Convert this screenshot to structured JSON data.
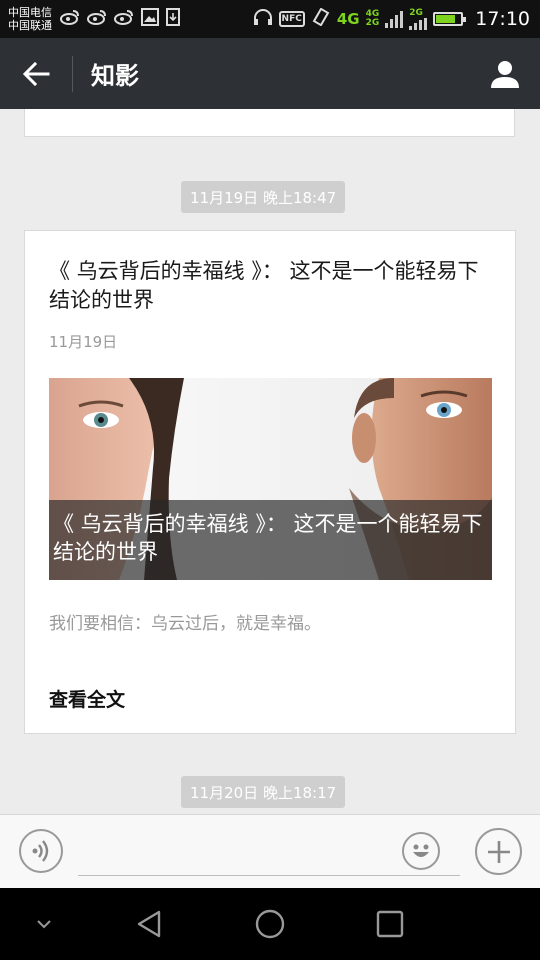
{
  "status_bar": {
    "carrier_1": "中国电信",
    "carrier_2": "中国联通",
    "icons": [
      "weibo-icon",
      "weibo-icon",
      "weibo-icon",
      "image-icon",
      "download-icon",
      "headphones-icon",
      "nfc-icon",
      "vibrate-icon"
    ],
    "nfc_label": "NFC",
    "network_4g": "4G",
    "network_4g_small": "4G",
    "network_2g_small": "2G",
    "network_2g": "2G",
    "battery_level": 0.8,
    "time": "17:10"
  },
  "title_bar": {
    "title": "知影",
    "back_icon": "arrow-left-icon",
    "profile_icon": "person-icon"
  },
  "messages": [
    {
      "timestamp": "11月19日 晚上18:47",
      "article": {
        "title": "《 乌云背后的幸福线 》：  这不是一个能轻易下结论的世界",
        "date": "11月19日",
        "cover_caption": "《 乌云背后的幸福线 》：  这不是一个能轻易下结论的世界",
        "digest": "我们要相信：乌云过后，就是幸福。",
        "read_more": "查看全文"
      }
    },
    {
      "timestamp": "11月20日 晚上18:17"
    }
  ],
  "input_bar": {
    "voice_icon": "voice-icon",
    "emoji_icon": "emoji-icon",
    "plus_icon": "plus-icon",
    "input_value": ""
  },
  "nav_bar": {
    "icons": [
      "collapse-icon",
      "back-triangle-icon",
      "home-circle-icon",
      "recents-square-icon"
    ]
  }
}
